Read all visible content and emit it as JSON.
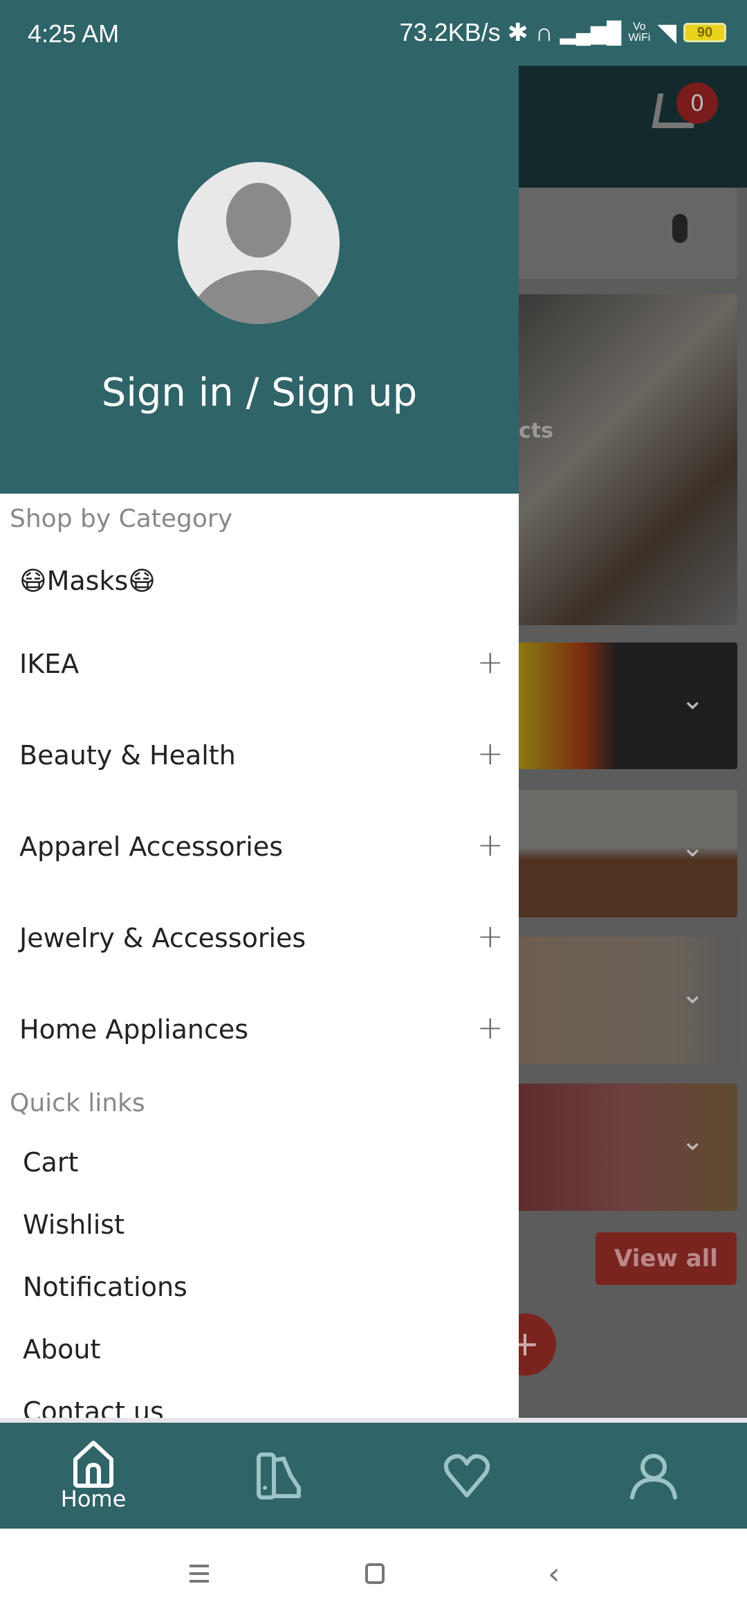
{
  "status_bar": {
    "time": "4:25 AM",
    "net_speed": "73.2KB/s",
    "vowifi_top": "Vo",
    "vowifi_bottom": "WiFi",
    "battery": "90"
  },
  "background_app": {
    "cart_count": "0",
    "hero_partial_text": "cts",
    "view_all": "View all",
    "fab": "+"
  },
  "drawer": {
    "sign_in": "Sign in / Sign up",
    "shop_by_category": "Shop by Category",
    "categories": [
      {
        "label": "😷Masks😷",
        "expandable": false
      },
      {
        "label": "IKEA",
        "expandable": true
      },
      {
        "label": "Beauty & Health",
        "expandable": true
      },
      {
        "label": "Apparel Accessories",
        "expandable": true
      },
      {
        "label": "Jewelry & Accessories",
        "expandable": true
      },
      {
        "label": "Home Appliances",
        "expandable": true
      }
    ],
    "expand_icon": "+",
    "quick_links_title": "Quick links",
    "quick_links": [
      "Cart",
      "Wishlist",
      "Notifications",
      "About",
      "Contact us"
    ]
  },
  "bottom_nav": {
    "items": [
      {
        "icon": "home-icon",
        "label": "Home",
        "active": true
      },
      {
        "icon": "catalog-icon",
        "label": ""
      },
      {
        "icon": "heart-icon",
        "label": ""
      },
      {
        "icon": "user-icon",
        "label": ""
      }
    ]
  },
  "colors": {
    "primary": "#2f6468",
    "accent": "#c0392b"
  }
}
